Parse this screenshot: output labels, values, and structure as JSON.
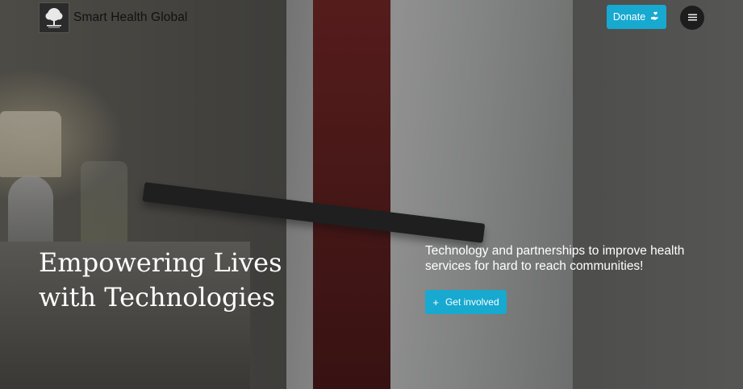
{
  "header": {
    "brand_name": "Smart Health Global",
    "donate_label": "Donate",
    "donate_icon": "hand-heart-icon",
    "menu_icon": "hamburger-menu-icon"
  },
  "hero": {
    "title_line1": "Empowering Lives",
    "title_line2": "with Technologies",
    "subtitle": "Technology and partnerships to improve health services for hard to reach communities!",
    "cta_label": "Get involved",
    "cta_icon": "plus-icon"
  },
  "colors": {
    "accent": "#17a9d0",
    "menu_button": "#1d1d1d",
    "text_on_image": "#ffffff"
  }
}
